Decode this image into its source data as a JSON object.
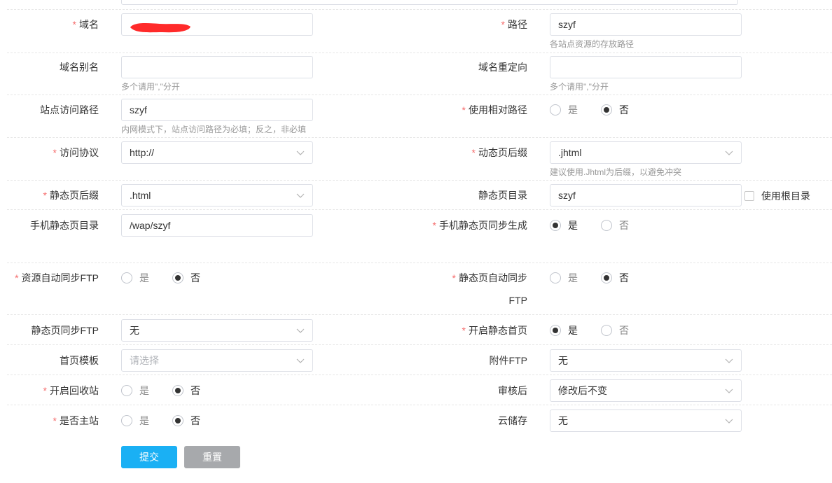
{
  "form": {
    "domain": {
      "label": "域名",
      "required": true,
      "value": ""
    },
    "path": {
      "label": "路径",
      "required": true,
      "value": "szyf",
      "hint": "各站点资源的存放路径"
    },
    "domain_alias": {
      "label": "域名别名",
      "value": "",
      "hint": "多个请用\",\"分开"
    },
    "domain_redirect": {
      "label": "域名重定向",
      "value": "",
      "hint": "多个请用\",\"分开"
    },
    "site_access_path": {
      "label": "站点访问路径",
      "value": "szyf",
      "hint": "内网模式下，站点访问路径为必填；反之，非必填"
    },
    "use_relative_path": {
      "label": "使用相对路径",
      "required": true,
      "options": [
        "是",
        "否"
      ],
      "selected": "否"
    },
    "protocol": {
      "label": "访问协议",
      "required": true,
      "value": "http://"
    },
    "dynamic_suffix": {
      "label": "动态页后缀",
      "required": true,
      "value": ".jhtml",
      "hint": "建议使用.Jhtml为后缀，以避免冲突"
    },
    "static_suffix": {
      "label": "静态页后缀",
      "required": true,
      "value": ".html"
    },
    "static_dir": {
      "label": "静态页目录",
      "value": "szyf",
      "checkbox_label": "使用根目录",
      "checked": false
    },
    "mobile_static_dir": {
      "label": "手机静态页目录",
      "value": "/wap/szyf"
    },
    "mobile_static_sync": {
      "label": "手机静态页同步生成",
      "required": true,
      "options": [
        "是",
        "否"
      ],
      "selected": "是"
    },
    "resource_auto_ftp": {
      "label": "资源自动同步FTP",
      "required": true,
      "options": [
        "是",
        "否"
      ],
      "selected": "否"
    },
    "static_auto_sync": {
      "label": "静态页自动同步FTP",
      "required": true,
      "options": [
        "是",
        "否"
      ],
      "selected": "否"
    },
    "static_sync_ftp": {
      "label": "静态页同步FTP",
      "value": "无"
    },
    "enable_static_home": {
      "label": "开启静态首页",
      "required": true,
      "options": [
        "是",
        "否"
      ],
      "selected": "是"
    },
    "home_template": {
      "label": "首页模板",
      "placeholder": "请选择",
      "value": ""
    },
    "attachment_ftp": {
      "label": "附件FTP",
      "value": "无"
    },
    "enable_recycle": {
      "label": "开启回收站",
      "required": true,
      "options": [
        "是",
        "否"
      ],
      "selected": "否"
    },
    "after_review": {
      "label": "审核后",
      "value": "修改后不变"
    },
    "is_main_site": {
      "label": "是否主站",
      "required": true,
      "options": [
        "是",
        "否"
      ],
      "selected": "否"
    },
    "cloud_storage": {
      "label": "云储存",
      "value": "无"
    }
  },
  "buttons": {
    "submit": "提交",
    "reset": "重置"
  },
  "colors": {
    "required_star": "#f56c6c",
    "submit_bg": "#1ab0f4",
    "reset_bg": "#a7a9ac",
    "redaction": "#ff2a2a"
  },
  "icons": {
    "select_arrow": "chevron-down-icon"
  }
}
